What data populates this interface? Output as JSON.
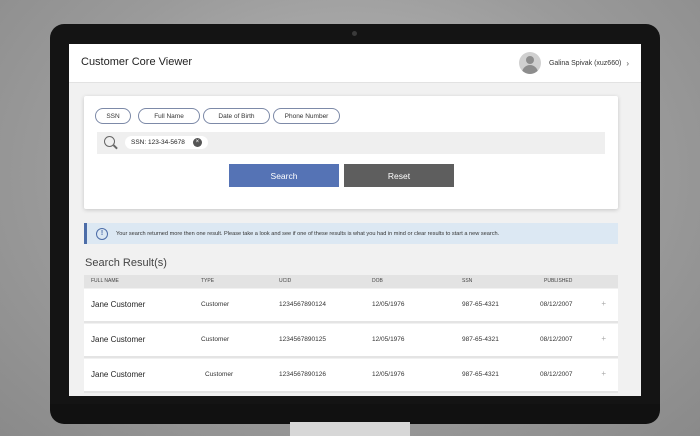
{
  "app": {
    "title": "Customer Core Viewer",
    "user_name": "Galina Spivak (xuz660)",
    "user_chevron": "›"
  },
  "search": {
    "chips": [
      "SSN",
      "Full Name",
      "Date of Birth",
      "Phone Number"
    ],
    "tag_value": "SSN: 123-34-5678",
    "tag_close": "×",
    "search_button": "Search",
    "reset_button": "Reset"
  },
  "info": {
    "icon": "!",
    "message": "Your search returned more then one result. Please take a look and see if one of these results is what you had in mind or clear results to start a new search."
  },
  "results": {
    "title": "Search Result(s)",
    "columns": [
      "FULL NAME",
      "TYPE",
      "UCID",
      "DOB",
      "SSN",
      "PUBLISHED"
    ],
    "rows": [
      {
        "name": "Jane Customer",
        "type": "Customer",
        "ucid": "1234567890124",
        "dob": "12/05/1976",
        "ssn": "987-65-4321",
        "published": "08/12/2007",
        "expand": "+"
      },
      {
        "name": "Jane Customer",
        "type": "Customer",
        "ucid": "1234567890125",
        "dob": "12/05/1976",
        "ssn": "987-65-4321",
        "published": "08/12/2007",
        "expand": "+"
      },
      {
        "name": "Jane Customer",
        "type": "Customer",
        "ucid": "1234567890126",
        "dob": "12/05/1976",
        "ssn": "987-65-4321",
        "published": "08/12/2007",
        "expand": "+"
      }
    ]
  },
  "colors": {
    "accent": "#5573b5",
    "reset": "#5e5e5e",
    "info_bg": "#dce8f3"
  }
}
